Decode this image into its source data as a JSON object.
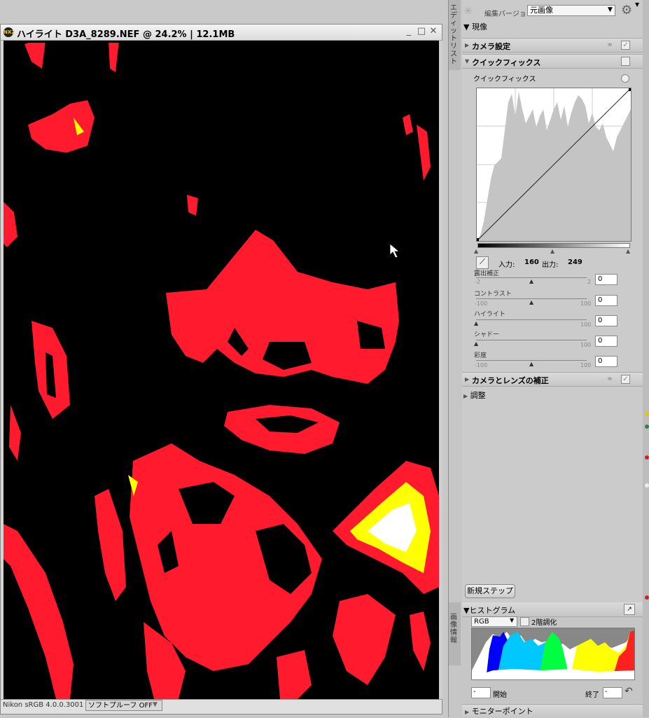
{
  "window": {
    "title": "ハイライト  D3A_8289.NEF @ 24.2% | 12.1MB",
    "logo": "NX2",
    "minimize": "_",
    "maximize": "□",
    "close": "✕"
  },
  "status": {
    "profile": "Nikon sRGB 4.0.0.3001",
    "softproof": "ソフトプルーフ OFF"
  },
  "palette": {
    "edit_list_tab": "エディットリスト",
    "version_label": "編集バージョン",
    "version_value": "元画像",
    "develop_header": "現像",
    "sections": {
      "camera_settings": "カメラ設定",
      "quick_fix": "クイックフィックス",
      "quick_fix_sub": "クイックフィックス",
      "camera_lens": "カメラとレンズの補正",
      "adjust": "調整"
    },
    "curve": {
      "input_label": "入力:",
      "input_value": "160",
      "output_label": "出力:",
      "output_value": "249"
    },
    "sliders": [
      {
        "label": "露出補正",
        "min": "-2",
        "max": "2",
        "value": "0",
        "pos": 0.5
      },
      {
        "label": "コントラスト",
        "min": "-100",
        "max": "100",
        "value": "0",
        "pos": 0.5
      },
      {
        "label": "ハイライト",
        "min": "",
        "max": "100",
        "value": "0",
        "pos": 0.0
      },
      {
        "label": "シャドー",
        "min": "",
        "max": "100",
        "value": "0",
        "pos": 0.0
      },
      {
        "label": "彩度",
        "min": "-100",
        "max": "100",
        "value": "0",
        "pos": 0.5
      }
    ],
    "new_step": "新規ステップ"
  },
  "histogram": {
    "tab": "画像情報",
    "title": "ヒストグラム",
    "channel": "RGB",
    "two_tone": "2階調化",
    "start_label": "開始",
    "start_value": "-",
    "end_label": "終了",
    "end_value": "-",
    "monitor_points": "モニターポイント"
  },
  "colors": {
    "highlight_red": "#ff1a2e",
    "highlight_yellow": "#ffff00",
    "canvas_bg": "#000000"
  }
}
